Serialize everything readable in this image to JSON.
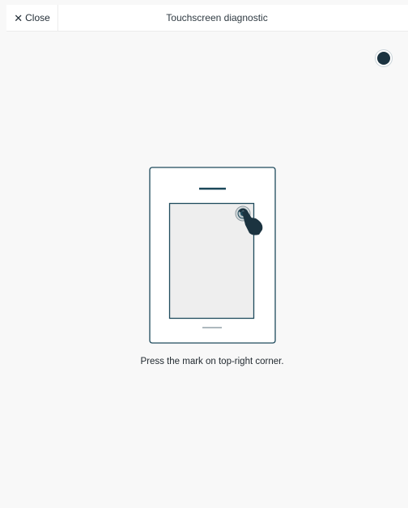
{
  "header": {
    "close_label": "Close",
    "close_icon": "close-x-icon",
    "title": "Touchscreen diagnostic"
  },
  "target": {
    "icon": "target-dot-icon"
  },
  "illustration": {
    "icon": "tablet-touch-illustration"
  },
  "instruction": "Press the mark on top-right corner.",
  "colors": {
    "accent": "#1e4a5c",
    "dot": "#1b3340",
    "background": "#f8f8f8"
  }
}
